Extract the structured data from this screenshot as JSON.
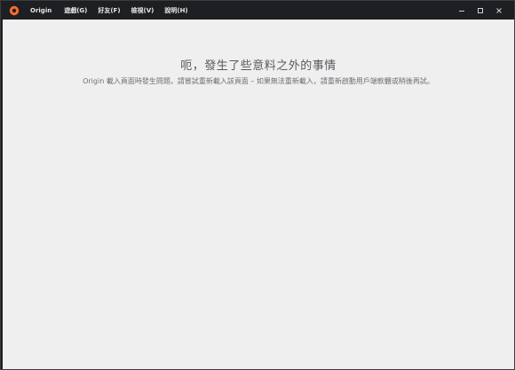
{
  "app": {
    "logo_icon": "origin-logo-icon",
    "accent_color": "#f56c2d"
  },
  "menu": {
    "brand": "Origin",
    "items": [
      {
        "label": "遊戲(G)"
      },
      {
        "label": "好友(F)"
      },
      {
        "label": "檢視(V)"
      },
      {
        "label": "說明(H)"
      }
    ]
  },
  "window_controls": {
    "minimize_icon": "minimize-icon",
    "maximize_icon": "maximize-icon",
    "close_icon": "close-icon"
  },
  "error": {
    "title": "呃，發生了些意料之外的事情",
    "message": "Origin 載入頁面時發生問題。請嘗試重新載入該頁面 – 如果無法重新載入，請重新啟動用戶端軟體或稍後再試。"
  }
}
